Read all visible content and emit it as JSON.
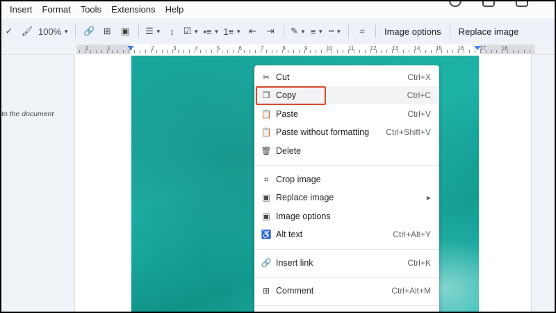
{
  "menubar": {
    "items": [
      "Insert",
      "Format",
      "Tools",
      "Extensions",
      "Help"
    ]
  },
  "toolbar": {
    "zoom": "100%",
    "image_options": "Image options",
    "replace_image": "Replace image"
  },
  "ruler": {
    "labels": [
      "2",
      "1",
      "1",
      "2",
      "3",
      "4",
      "5",
      "6",
      "7",
      "8",
      "9",
      "10",
      "11",
      "12",
      "13",
      "14",
      "15",
      "16",
      "17",
      "18"
    ]
  },
  "side_hint": "to the document",
  "context_menu": {
    "cut": {
      "label": "Cut",
      "shortcut": "Ctrl+X",
      "icon": "scissors-icon"
    },
    "copy": {
      "label": "Copy",
      "shortcut": "Ctrl+C",
      "icon": "copy-icon"
    },
    "paste": {
      "label": "Paste",
      "shortcut": "Ctrl+V",
      "icon": "clipboard-icon"
    },
    "paste_plain": {
      "label": "Paste without formatting",
      "shortcut": "Ctrl+Shift+V",
      "icon": "clipboard-plain-icon"
    },
    "delete": {
      "label": "Delete",
      "shortcut": "",
      "icon": "trash-icon"
    },
    "crop": {
      "label": "Crop image",
      "shortcut": "",
      "icon": "crop-icon"
    },
    "replace": {
      "label": "Replace image",
      "shortcut": "",
      "icon": "image-icon"
    },
    "options": {
      "label": "Image options",
      "shortcut": "",
      "icon": "image-icon"
    },
    "alt": {
      "label": "Alt text",
      "shortcut": "Ctrl+Alt+Y",
      "icon": "accessibility-icon"
    },
    "link": {
      "label": "Insert link",
      "shortcut": "Ctrl+K",
      "icon": "link-icon"
    },
    "comment": {
      "label": "Comment",
      "shortcut": "Ctrl+Alt+M",
      "icon": "comment-add-icon"
    }
  },
  "colors": {
    "highlight_border": "#d9472b",
    "image_teal": "#1aa89d"
  }
}
